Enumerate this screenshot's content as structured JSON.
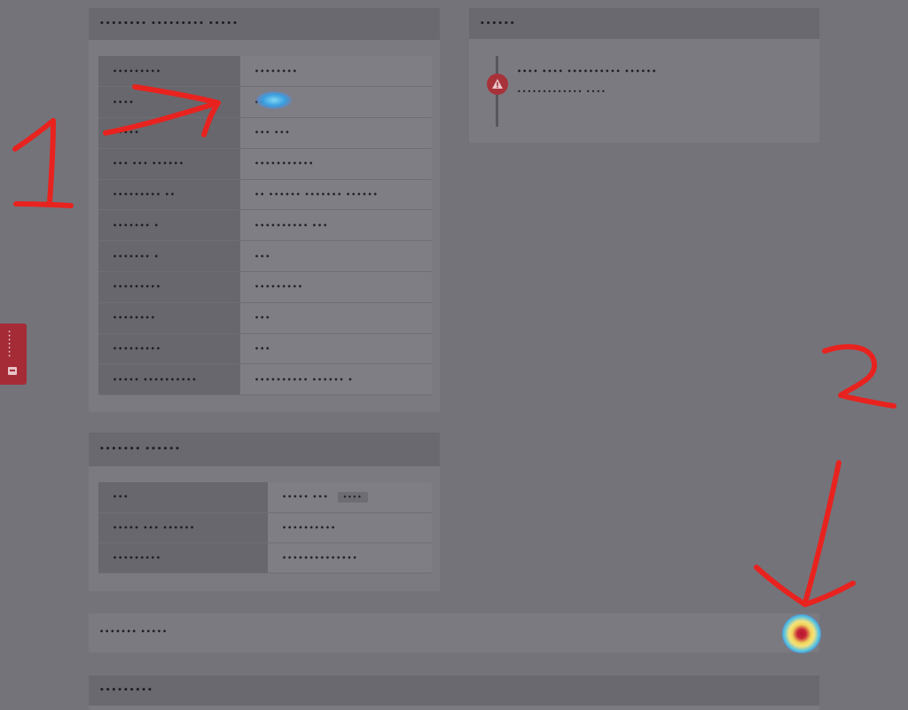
{
  "left_tab": {
    "label": "•••••••"
  },
  "info_panel": {
    "title": "•••••••• ••••••••• •••••",
    "rows": [
      {
        "key": "•••••••••",
        "value": "••••••••"
      },
      {
        "key": "••••",
        "value": "••••••"
      },
      {
        "key": "•••••",
        "value": "••• •••"
      },
      {
        "key": "••• ••• ••••••",
        "value": "•••••••••••"
      },
      {
        "key": "••••••••• ••",
        "value": "•• •••••• ••••••• ••••••"
      },
      {
        "key": "••••••• •",
        "value": "•••••••••• •••"
      },
      {
        "key": "••••••• •",
        "value": "•••"
      },
      {
        "key": "•••••••••",
        "value": "•••••••••"
      },
      {
        "key": "••••••••",
        "value": "•••"
      },
      {
        "key": "•••••••••",
        "value": "•••"
      },
      {
        "key": "••••• ••••••••••",
        "value": "•••••••••• •••••• •"
      }
    ]
  },
  "status_panel": {
    "title": "••••••",
    "line1": "•••• •••• •••••••••• ••••••",
    "line2": "••••••••••••• ••••"
  },
  "second_panel": {
    "title": "••••••• ••••••",
    "rows": [
      {
        "key": "•••",
        "value": "••••• •••",
        "badge": "••••"
      },
      {
        "key": "••••• ••• ••••••",
        "value": "••••••••••"
      },
      {
        "key": "•••••••••",
        "value": "••••••••••••••"
      }
    ]
  },
  "collapsible_bar": {
    "label": "••••••• •••••"
  },
  "bottom_panel": {
    "title": "•••••••••"
  },
  "annotations": {
    "label_1": "1",
    "label_2": "2"
  },
  "colors": {
    "annotation_red": "#e8231f",
    "warning_red": "#a8323a",
    "overlay_gray": "#74737a"
  }
}
